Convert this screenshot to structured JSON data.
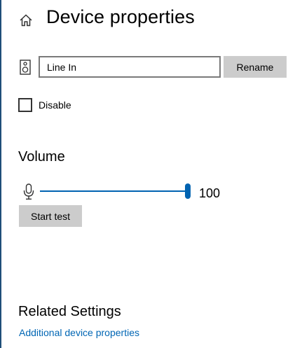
{
  "header": {
    "title": "Device properties"
  },
  "device": {
    "name_value": "Line In",
    "rename_label": "Rename"
  },
  "disable": {
    "label": "Disable",
    "checked": false
  },
  "volume": {
    "heading": "Volume",
    "value": "100",
    "level_percent": 100,
    "start_test_label": "Start test"
  },
  "related": {
    "heading": "Related Settings",
    "link_additional": "Additional device properties"
  },
  "colors": {
    "accent": "#0063b1",
    "link": "#0066b4",
    "button_bg": "#cccccc"
  },
  "icons": {
    "home": "home-icon",
    "device": "speaker-device-icon",
    "mic": "microphone-icon"
  }
}
